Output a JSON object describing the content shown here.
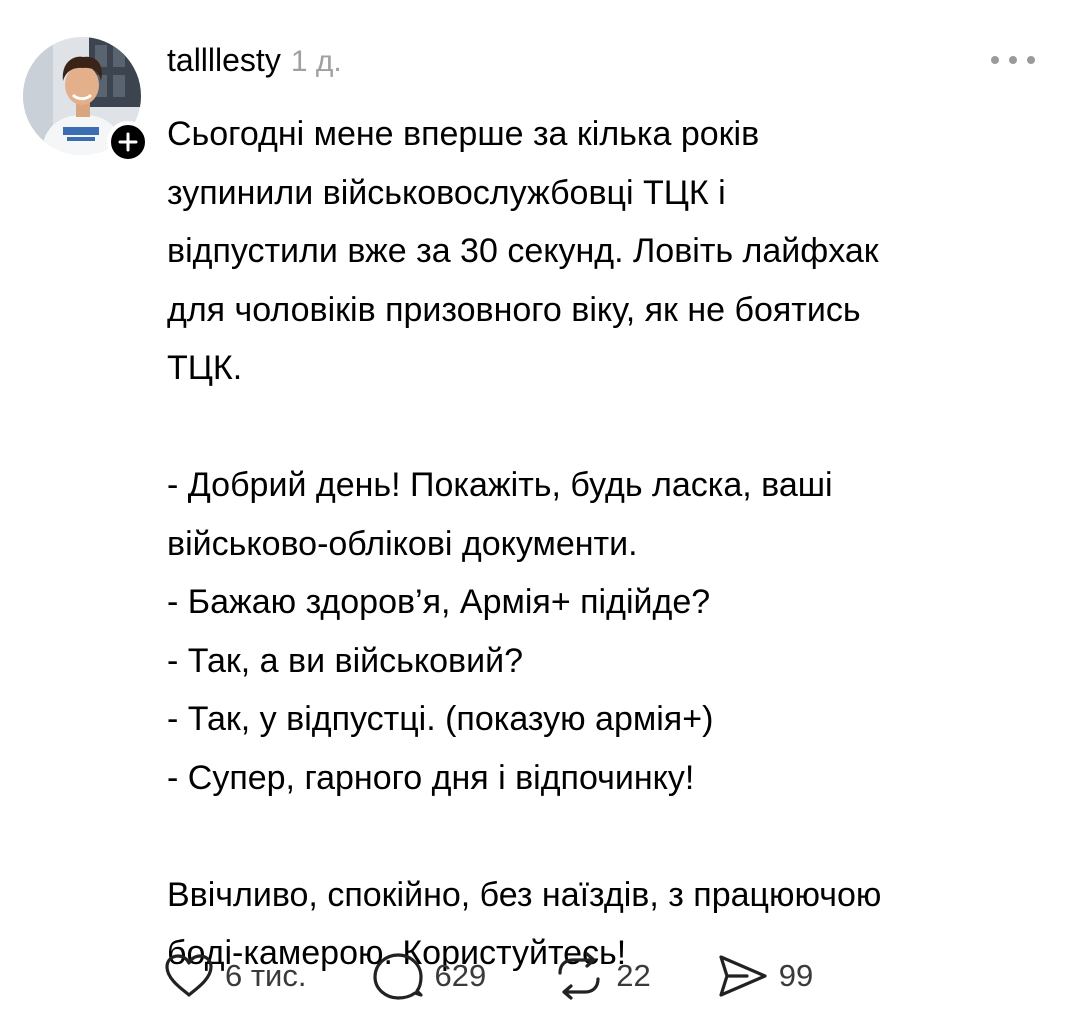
{
  "post": {
    "username": "tallllesty",
    "time": "1 д.",
    "paragraphs": [
      [
        "Сьогодні мене вперше за кілька років",
        "зупинили військовослужбовці ТЦК і",
        "відпустили вже за 30 секунд. Ловіть лайфхак",
        "для чоловіків призовного віку, як не боятись",
        "ТЦК."
      ],
      [
        "- Добрий день! Покажіть, будь ласка, ваші",
        "військово-облікові документи.",
        "- Бажаю здоров’я, Армія+ підійде?",
        "- Так, а ви військовий?",
        "- Так, у відпустці. (показую армія+)",
        "- Супер, гарного дня і відпочинку!"
      ],
      [
        "Ввічливо, спокійно, без наїздів, з працюючою",
        "боді-камерою. Користуйтесь!"
      ]
    ]
  },
  "actions": {
    "likes": "6 тис.",
    "comments": "629",
    "reposts": "22",
    "shares": "99"
  },
  "icons": {
    "like": "heart-icon",
    "comment": "speech-bubble-icon",
    "repost": "repost-icon",
    "share": "paper-plane-icon",
    "more": "ellipsis-icon",
    "follow": "plus-icon"
  },
  "colors": {
    "text": "#000000",
    "muted": "#a0a0a0",
    "action_text": "#3a3a3a"
  }
}
